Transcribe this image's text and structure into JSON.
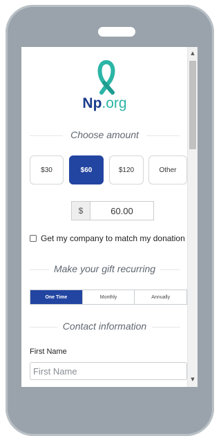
{
  "logo": {
    "brand_bold": "Np",
    "brand_rest": ".org"
  },
  "sections": {
    "choose_amount": "Choose amount",
    "recurring": "Make your gift recurring",
    "contact": "Contact information"
  },
  "amounts": [
    {
      "label": "$30",
      "selected": false
    },
    {
      "label": "$60",
      "selected": true
    },
    {
      "label": "$120",
      "selected": false
    },
    {
      "label": "Other",
      "selected": false
    }
  ],
  "custom_amount": {
    "currency_symbol": "$",
    "value": "60.00"
  },
  "match": {
    "label": "Get my company to match my donation",
    "checked": false
  },
  "frequency": [
    {
      "label": "One Time",
      "active": true
    },
    {
      "label": "Monthly",
      "active": false
    },
    {
      "label": "Annually",
      "active": false
    }
  ],
  "contact": {
    "first_name_label": "First Name",
    "first_name_placeholder": "First Name"
  },
  "colors": {
    "primary": "#2245a1",
    "ribbon": "#2bb5a6",
    "phone_frame": "#9aa3ab"
  }
}
